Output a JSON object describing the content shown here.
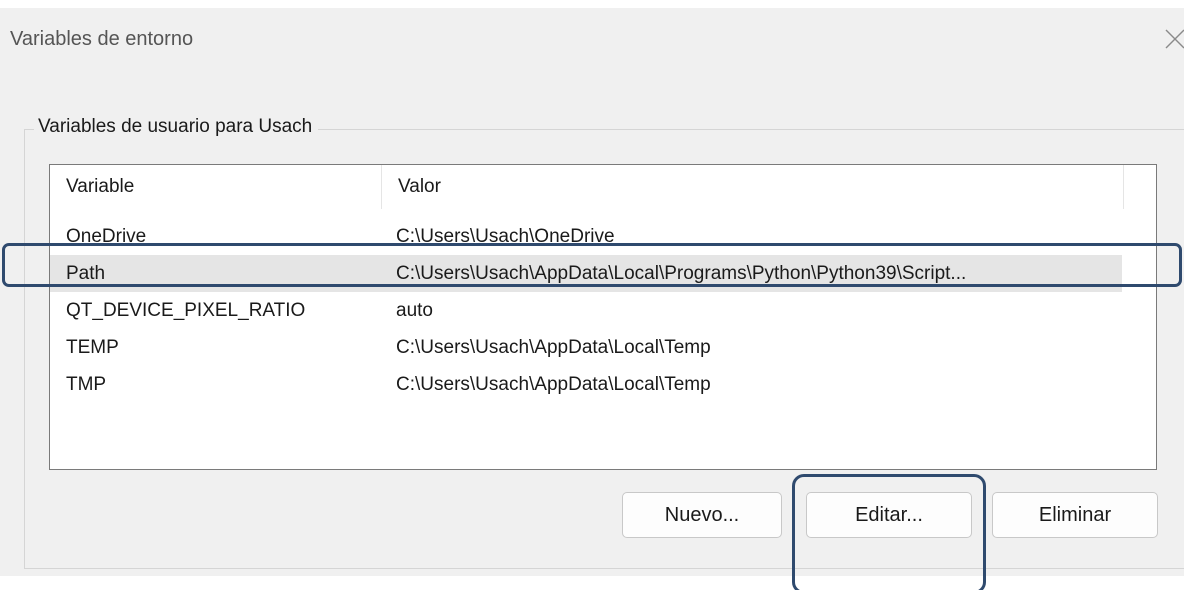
{
  "window": {
    "title": "Variables de entorno",
    "close_icon": "close-icon"
  },
  "user_group": {
    "label": "Variables de usuario para Usach",
    "columns": {
      "variable": "Variable",
      "value": "Valor"
    },
    "rows": [
      {
        "variable": "OneDrive",
        "value": "C:\\Users\\Usach\\OneDrive"
      },
      {
        "variable": "Path",
        "value": "C:\\Users\\Usach\\AppData\\Local\\Programs\\Python\\Python39\\Script..."
      },
      {
        "variable": "QT_DEVICE_PIXEL_RATIO",
        "value": "auto"
      },
      {
        "variable": "TEMP",
        "value": "C:\\Users\\Usach\\AppData\\Local\\Temp"
      },
      {
        "variable": "TMP",
        "value": "C:\\Users\\Usach\\AppData\\Local\\Temp"
      }
    ],
    "selected_row": "Path"
  },
  "buttons": {
    "new_label": "Nuevo...",
    "edit_label": "Editar...",
    "delete_label": "Eliminar"
  },
  "colors": {
    "dialog_bg": "#f0f0f0",
    "selection_bg": "#e5e5e5",
    "annotation_border": "#2f4a6e"
  }
}
